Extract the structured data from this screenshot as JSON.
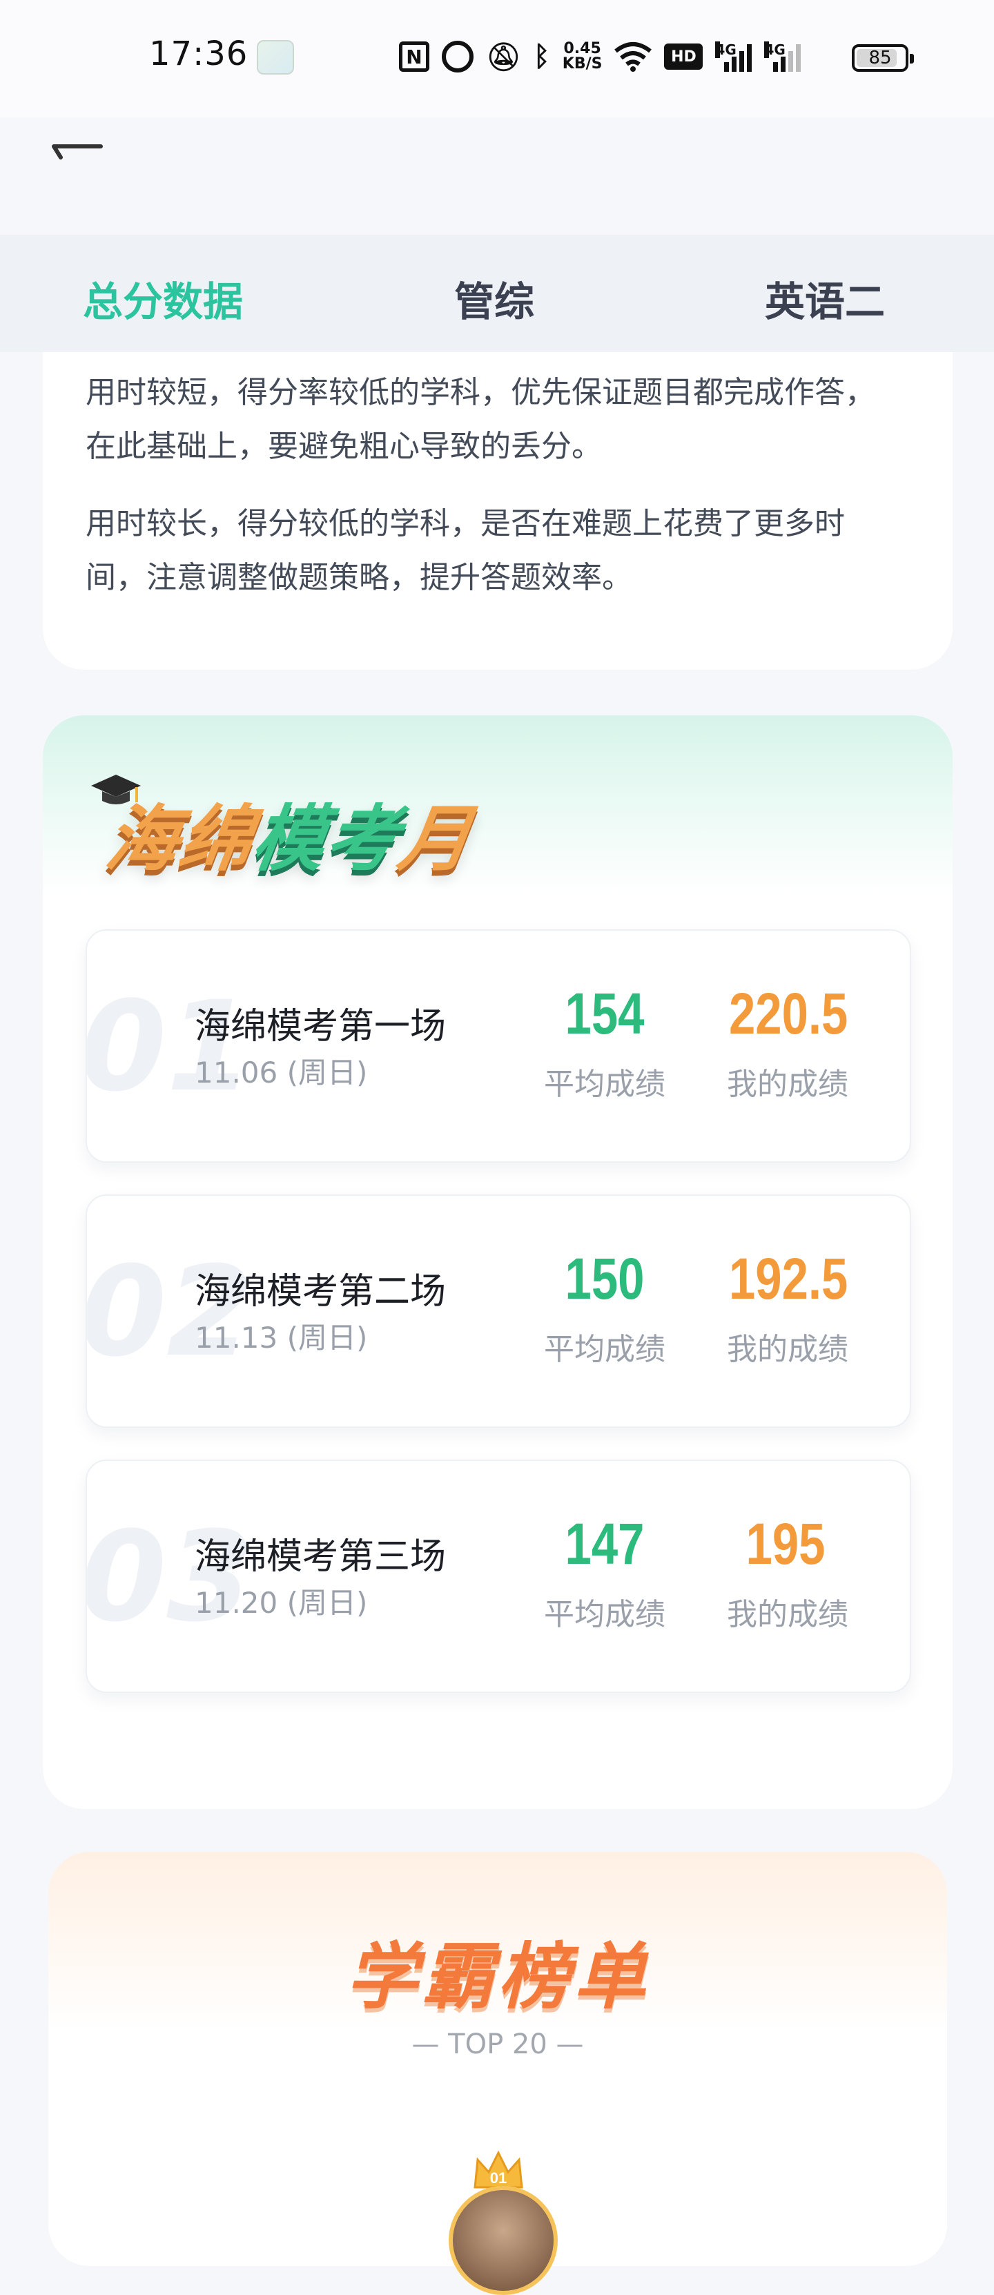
{
  "status_bar": {
    "time": "17:36",
    "net_speed_value": "0.45",
    "net_speed_unit": "KB/S",
    "hd_label": "HD",
    "network_1": "4G",
    "network_2": "4G",
    "battery": "85",
    "battery_level": 0.85
  },
  "tabs": [
    {
      "label": "总分数据",
      "active": true
    },
    {
      "label": "管综",
      "active": false
    },
    {
      "label": "英语二",
      "active": false
    }
  ],
  "tips": [
    "用时较短，得分率较低的学科，优先保证题目都完成作答，在此基础上，要避免粗心导致的丢分。",
    "用时较长，得分较低的学科，是否在难题上花费了更多时间，注意调整做题策略，提升答题效率。"
  ],
  "mock_section": {
    "title_part1": "海绵",
    "title_part2": "模考",
    "title_part3": "月",
    "avg_label": "平均成绩",
    "mine_label": "我的成绩",
    "exams": [
      {
        "index": "01",
        "name": "海绵模考第一场",
        "date": "11.06 (周日)",
        "avg": "154",
        "mine": "220.5"
      },
      {
        "index": "02",
        "name": "海绵模考第二场",
        "date": "11.13 (周日)",
        "avg": "150",
        "mine": "192.5"
      },
      {
        "index": "03",
        "name": "海绵模考第三场",
        "date": "11.20 (周日)",
        "avg": "147",
        "mine": "195"
      }
    ]
  },
  "rank_section": {
    "title": "学霸榜单",
    "subtitle": "— TOP 20 —",
    "first_badge": "01"
  },
  "colors": {
    "accent": "#2cc49e",
    "avg_green": "#2dbb7d",
    "mine_orange": "#f39a3a",
    "rank_orange": "#f47a3c"
  }
}
